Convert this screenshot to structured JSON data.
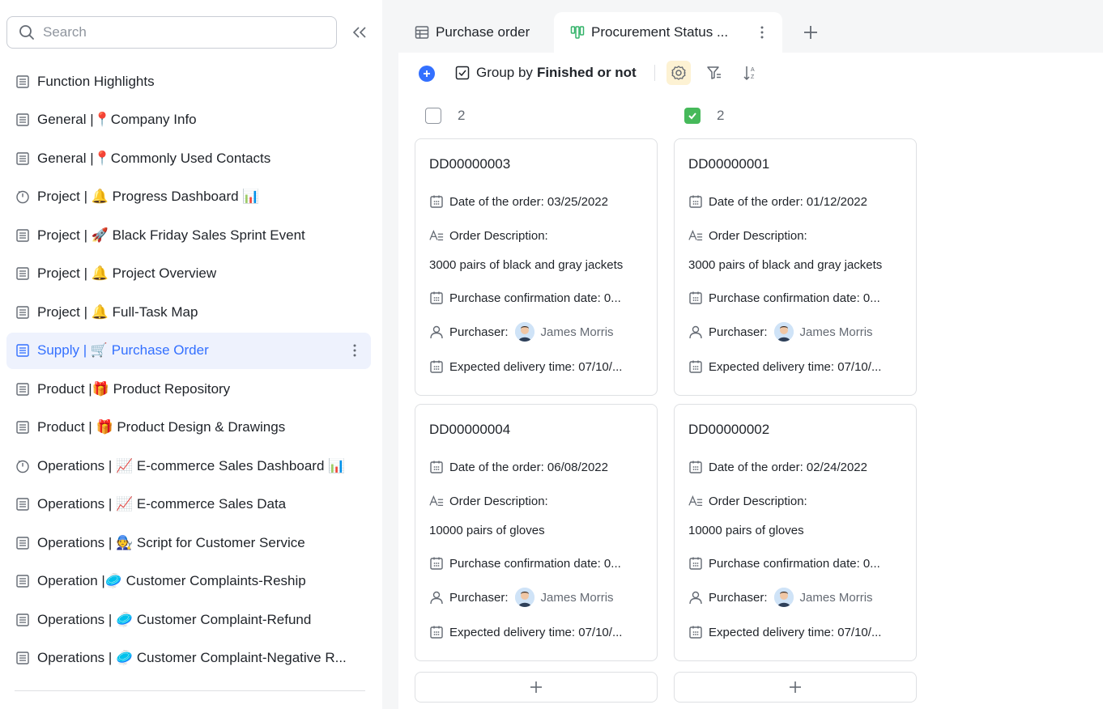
{
  "sidebar": {
    "search_placeholder": "Search",
    "items": [
      {
        "label": "Function Highlights",
        "icon": "grid-icon"
      },
      {
        "label": "General |📍Company Info",
        "icon": "grid-icon"
      },
      {
        "label": "General |📍Commonly Used Contacts",
        "icon": "grid-icon"
      },
      {
        "label": "Project | 🔔 Progress Dashboard 📊",
        "icon": "dashboard-icon"
      },
      {
        "label": "Project | 🚀 Black Friday Sales Sprint Event",
        "icon": "grid-icon"
      },
      {
        "label": "Project | 🔔 Project Overview",
        "icon": "grid-icon"
      },
      {
        "label": "Project | 🔔 Full-Task Map",
        "icon": "grid-icon"
      },
      {
        "label": "Supply | 🛒 Purchase Order",
        "icon": "grid-icon",
        "active": true
      },
      {
        "label": "Product |🎁 Product Repository",
        "icon": "grid-icon"
      },
      {
        "label": "Product | 🎁 Product Design & Drawings",
        "icon": "grid-icon"
      },
      {
        "label": "Operations | 📈 E-commerce Sales Dashboard 📊",
        "icon": "dashboard-icon"
      },
      {
        "label": "Operations | 📈 E-commerce Sales Data",
        "icon": "grid-icon"
      },
      {
        "label": "Operations | 🧑‍🔧 Script for Customer Service",
        "icon": "grid-icon"
      },
      {
        "label": "Operation |🥏 Customer Complaints-Reship",
        "icon": "grid-icon"
      },
      {
        "label": "Operations | 🥏 Customer Complaint-Refund",
        "icon": "grid-icon"
      },
      {
        "label": "Operations | 🥏 Customer Complaint-Negative R...",
        "icon": "grid-icon"
      }
    ]
  },
  "tabs": [
    {
      "label": "Purchase order",
      "icon": "table-icon"
    },
    {
      "label": "Procurement Status ...",
      "icon": "kanban-icon",
      "active": true
    }
  ],
  "toolbar": {
    "group_prefix": "Group by",
    "group_field": "Finished or not"
  },
  "columns": [
    {
      "checked": false,
      "count": "2",
      "cards": [
        {
          "id": "DD00000003",
          "order_date": "Date of the order: 03/25/2022",
          "desc_label": "Order Description:",
          "desc_value": "3000 pairs of black and gray jackets",
          "confirm": "Purchase confirmation date: 0...",
          "purchaser_label": "Purchaser:",
          "purchaser": "James Morris",
          "delivery": "Expected delivery time: 07/10/..."
        },
        {
          "id": "DD00000004",
          "order_date": "Date of the order: 06/08/2022",
          "desc_label": "Order Description:",
          "desc_value": "10000 pairs of gloves",
          "confirm": "Purchase confirmation date: 0...",
          "purchaser_label": "Purchaser:",
          "purchaser": "James Morris",
          "delivery": "Expected delivery time: 07/10/..."
        }
      ]
    },
    {
      "checked": true,
      "count": "2",
      "cards": [
        {
          "id": "DD00000001",
          "order_date": "Date of the order: 01/12/2022",
          "desc_label": "Order Description:",
          "desc_value": "3000 pairs of black and gray jackets",
          "confirm": "Purchase confirmation date: 0...",
          "purchaser_label": "Purchaser:",
          "purchaser": "James Morris",
          "delivery": "Expected delivery time: 07/10/..."
        },
        {
          "id": "DD00000002",
          "order_date": "Date of the order: 02/24/2022",
          "desc_label": "Order Description:",
          "desc_value": "10000 pairs of gloves",
          "confirm": "Purchase confirmation date: 0...",
          "purchaser_label": "Purchaser:",
          "purchaser": "James Morris",
          "delivery": "Expected delivery time: 07/10/..."
        }
      ]
    }
  ],
  "colors": {
    "accent": "#3370ff",
    "active_bg": "#eef2fd",
    "checked_green": "#46b95a",
    "settings_bg": "#fdf2d3"
  }
}
